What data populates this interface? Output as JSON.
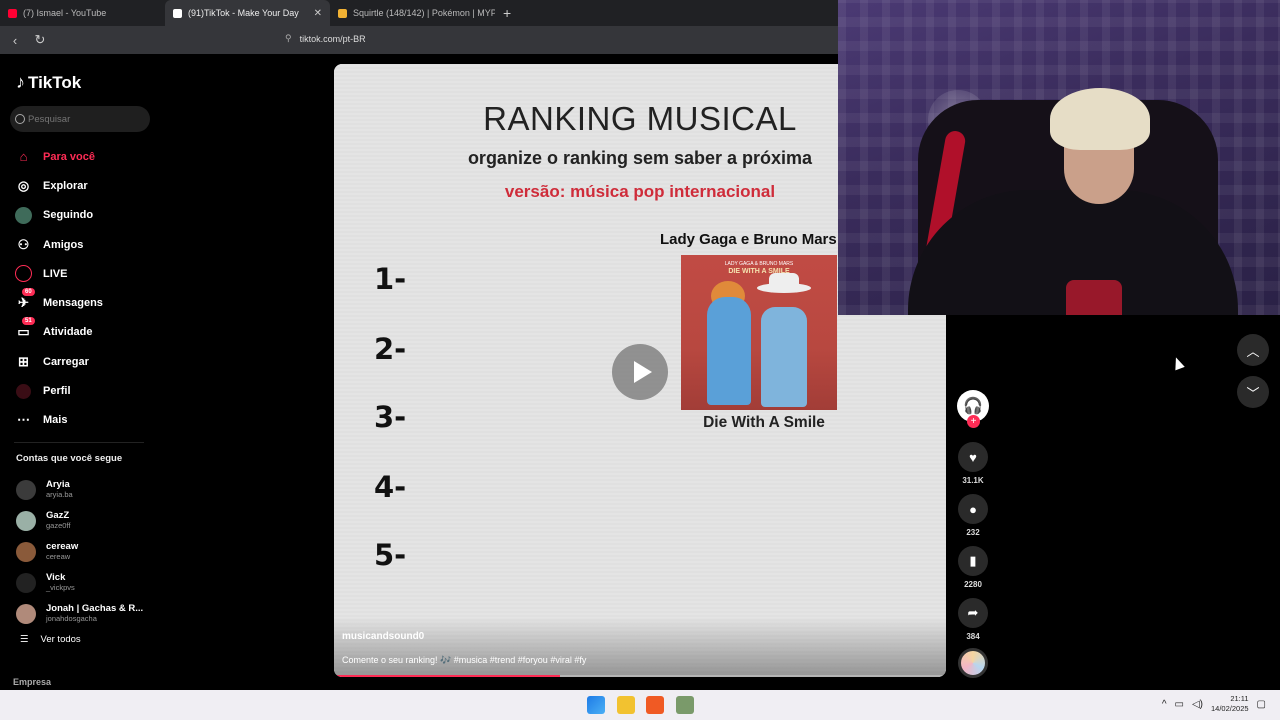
{
  "browser": {
    "tabs": [
      {
        "label": "(7) Ismael - YouTube",
        "favicon_color": "#ff0033"
      },
      {
        "label": "(91)TikTok - Make Your Day",
        "favicon_color": "#ffffff"
      },
      {
        "label": "Squirtle (148/142) | Pokémon | MYP",
        "favicon_color": "#f2b233"
      }
    ],
    "url": "tiktok.com/pt-BR"
  },
  "sidebar": {
    "brand": "TikTok",
    "search_placeholder": "Pesquisar",
    "nav": [
      {
        "label": "Para você",
        "icon": "home-icon"
      },
      {
        "label": "Explorar",
        "icon": "compass-icon"
      },
      {
        "label": "Seguindo",
        "icon": "following-icon"
      },
      {
        "label": "Amigos",
        "icon": "friends-icon"
      },
      {
        "label": "LIVE",
        "icon": "live-icon"
      },
      {
        "label": "Mensagens",
        "icon": "messages-icon",
        "badge": "60"
      },
      {
        "label": "Atividade",
        "icon": "activity-icon",
        "badge": "51"
      },
      {
        "label": "Carregar",
        "icon": "upload-icon"
      },
      {
        "label": "Perfil",
        "icon": "profile-icon"
      },
      {
        "label": "Mais",
        "icon": "more-icon"
      }
    ],
    "following_title": "Contas que você segue",
    "following": [
      {
        "name": "Aryia",
        "handle": "aryia.ba"
      },
      {
        "name": "GazZ",
        "handle": "gaze0ff"
      },
      {
        "name": "cereaw",
        "handle": "cereaw"
      },
      {
        "name": "Vick",
        "handle": "_vickpvs"
      },
      {
        "name": "Jonah | Gachas & R...",
        "handle": "jonahdosgacha"
      }
    ],
    "see_all": "Ver todos",
    "footer": "Empresa"
  },
  "video": {
    "title": "RANKING MUSICAL",
    "subtitle": "organize o ranking sem saber a próxima",
    "version": "versão: música pop internacional",
    "ranks": [
      "1-",
      "2-",
      "3-",
      "4-",
      "5-"
    ],
    "artist": "Lady Gaga e Bruno Mars",
    "cover_text_small": "LADY GAGA & BRUNO MARS",
    "cover_text_title": "DIE WITH A SMILE",
    "song": "Die With A Smile",
    "username": "musicandsound0",
    "description": "Comente o seu ranking! 🎶 #musica #trend #foryou #viral #fy",
    "progress": 0.37
  },
  "actions": {
    "likes": "31.1K",
    "comments": "232",
    "saves": "2280",
    "shares": "384"
  },
  "taskbar": {
    "time": "21:11",
    "date": "14/02/2025"
  },
  "colors": {
    "accent": "#fe2c55",
    "version_red": "#cf2c3a"
  }
}
